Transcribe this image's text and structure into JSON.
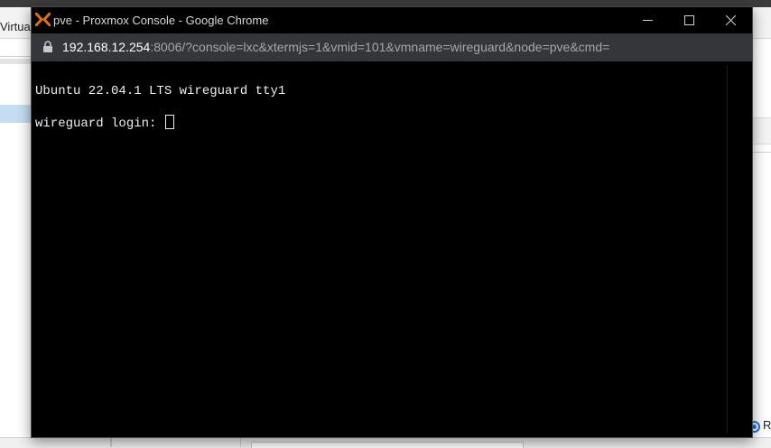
{
  "background_app": {
    "header_text": "Virtual",
    "radio_label": "R"
  },
  "window": {
    "title": "pve - Proxmox Console - Google Chrome",
    "url_host": "192.168.12.254",
    "url_rest": ":8006/?console=lxc&xtermjs=1&vmid=101&vmname=wireguard&node=pve&cmd=",
    "controls": {
      "minimize_icon": "minimize-icon",
      "maximize_icon": "maximize-icon",
      "close_icon": "close-icon"
    }
  },
  "terminal": {
    "line1": "Ubuntu 22.04.1 LTS wireguard tty1",
    "prompt": "wireguard login: "
  },
  "colors": {
    "accent_logo": "#e57000",
    "terminal_bg": "#000000",
    "terminal_fg": "#f0f0f0",
    "address_bar_bg": "#35363a"
  }
}
